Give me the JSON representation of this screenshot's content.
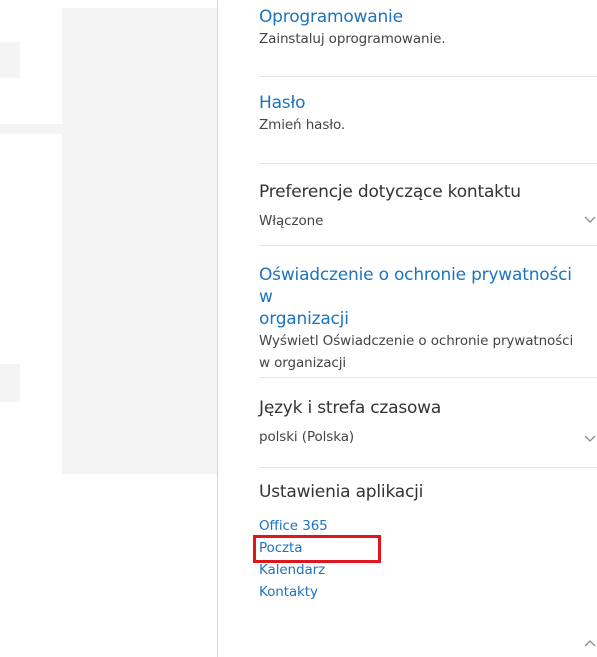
{
  "sections": {
    "software": {
      "title": "Oprogramowanie",
      "desc": "Zainstaluj oprogramowanie."
    },
    "password": {
      "title": "Hasło",
      "desc": "Zmień hasło."
    },
    "contact": {
      "title": "Preferencje dotyczące kontaktu",
      "value": "Włączone"
    },
    "privacy": {
      "title_line1": "Oświadczenie o ochronie prywatności w",
      "title_line2": "organizacji",
      "desc_line1": "Wyświetl Oświadczenie o ochronie prywatności",
      "desc_line2": "w organizacji"
    },
    "language": {
      "title": "Język i strefa czasowa",
      "value": "polski (Polska)"
    },
    "apps": {
      "title": "Ustawienia aplikacji",
      "links": [
        "Office 365",
        "Poczta",
        "Kalendarz",
        "Kontakty"
      ]
    }
  },
  "colors": {
    "link": "#1e73be",
    "highlight": "#e0161f"
  },
  "icons": {
    "expand": "chevron-down-icon",
    "collapse": "chevron-up-icon"
  }
}
